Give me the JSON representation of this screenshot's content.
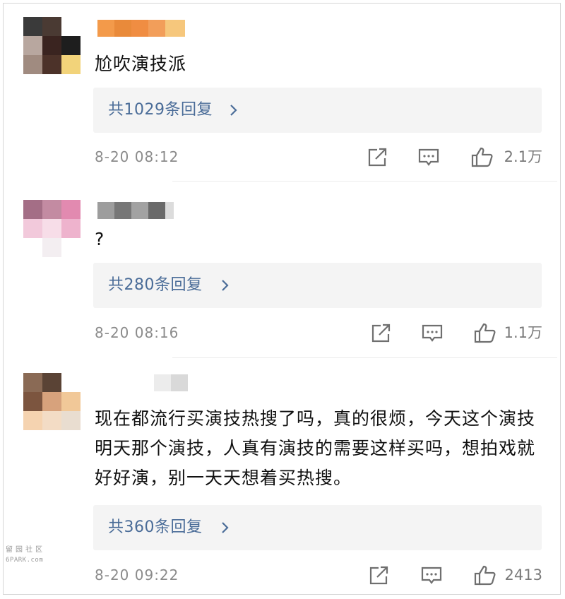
{
  "comments": [
    {
      "text": "尬吹演技派",
      "reply_label": "共1029条回复",
      "time": "8-20 08:12",
      "likes": "2.1万"
    },
    {
      "text": "?",
      "reply_label": "共280条回复",
      "time": "8-20 08:16",
      "likes": "1.1万"
    },
    {
      "text": "现在都流行买演技热搜了吗，真的很烦，今天这个演技明天那个演技，人真有演技的需要这样买吗，想拍戏就好好演，别一天天想着买热搜。",
      "reply_label": "共360条回复",
      "time": "8-20 09:22",
      "likes": "2413"
    }
  ],
  "watermark": {
    "line1": "留园社区",
    "line2": "6PARK.com"
  },
  "colors": {
    "reply_link": "#4a6c98",
    "reply_bg": "#f4f4f4",
    "meta_text": "#8b8b8b",
    "icon_stroke": "#6f6f6f"
  },
  "icons": [
    "share-icon",
    "comment-icon",
    "thumbs-up-icon",
    "chevron-right-icon"
  ]
}
